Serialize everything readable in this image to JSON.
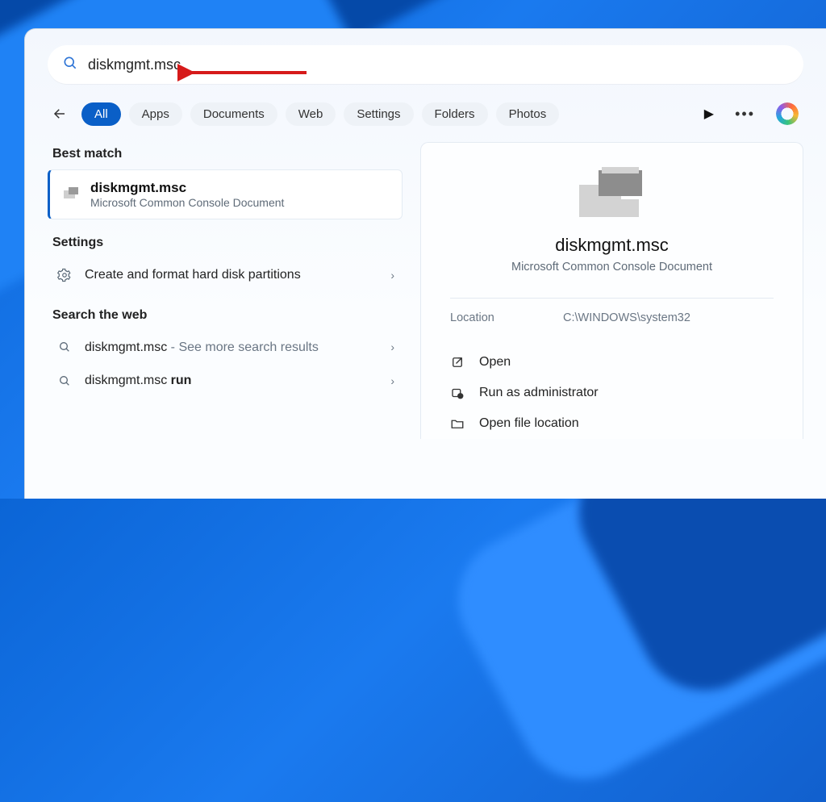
{
  "search": {
    "query": "diskmgmt.msc"
  },
  "filters": {
    "all": "All",
    "apps": "Apps",
    "documents": "Documents",
    "web": "Web",
    "settings": "Settings",
    "folders": "Folders",
    "photos": "Photos"
  },
  "sections": {
    "best_match": "Best match",
    "settings": "Settings",
    "search_web": "Search the web"
  },
  "best_match": {
    "title": "diskmgmt.msc",
    "subtitle": "Microsoft Common Console Document"
  },
  "settings_results": [
    {
      "label": "Create and format hard disk partitions"
    }
  ],
  "web_results": [
    {
      "prefix": "diskmgmt.msc",
      "suffix": " - See more search results"
    },
    {
      "prefix": "diskmgmt.msc ",
      "bold": "run"
    }
  ],
  "detail": {
    "title": "diskmgmt.msc",
    "subtitle": "Microsoft Common Console Document",
    "location_label": "Location",
    "location_value": "C:\\WINDOWS\\system32",
    "actions": {
      "open": "Open",
      "run_admin": "Run as administrator",
      "open_location": "Open file location"
    }
  }
}
